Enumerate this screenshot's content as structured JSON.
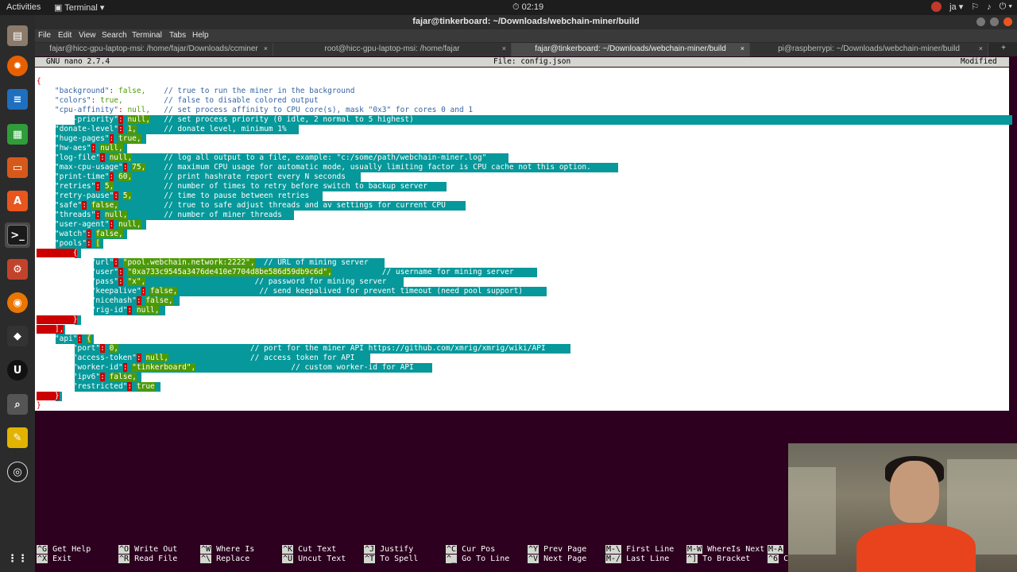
{
  "topbar": {
    "activities": "Activities",
    "app_menu": "Terminal ▾",
    "clock": "02:19",
    "language": "ja ▾"
  },
  "dock": {
    "items": [
      "files-icon",
      "firefox-icon",
      "writer-icon",
      "calc-icon",
      "impress-icon",
      "software-icon",
      "terminal-icon",
      "settings-icon",
      "blender-icon",
      "unity-icon",
      "unreal-icon",
      "search-icon",
      "editor-icon",
      "obs-icon",
      "apps-grid-icon"
    ]
  },
  "window": {
    "title": "fajar@tinkerboard: ~/Downloads/webchain-miner/build",
    "menu": [
      "File",
      "Edit",
      "View",
      "Search",
      "Terminal",
      "Tabs",
      "Help"
    ],
    "tabs": [
      {
        "label": "fajar@hicc-gpu-laptop-msi: /home/fajar/Downloads/ccminer",
        "close": "×"
      },
      {
        "label": "root@hicc-gpu-laptop-msi: /home/fajar",
        "close": "×"
      },
      {
        "label": "fajar@tinkerboard: ~/Downloads/webchain-miner/build",
        "close": "×"
      },
      {
        "label": "pi@raspberrypi: ~/Downloads/webchain-miner/build",
        "close": "×"
      }
    ],
    "tab_plus": "+"
  },
  "nano": {
    "version": "GNU nano 2.7.4",
    "file": "File: config.json",
    "status": "Modified",
    "lines": [
      "{",
      "    \"background\": false,    // true to run the miner in the background",
      "    \"colors\": true,         // false to disable colored output",
      "    \"cpu-affinity\": null,   // set process affinity to CPU core(s), mask \"0x3\" for cores 0 and 1",
      "    \"cpu-priority\": null,   // set process priority (0 idle, 2 normal to 5 highest)",
      "    \"donate-level\": 1,      // donate level, minimum 1%",
      "    \"huge-pages\": true,",
      "    \"hw-aes\": null,",
      "    \"log-file\": null,       // log all output to a file, example: \"c:/some/path/webchain-miner.log\"",
      "    \"max-cpu-usage\": 75,    // maximum CPU usage for automatic mode, usually limiting factor is CPU cache not this option.",
      "    \"print-time\": 60,       // print hashrate report every N seconds",
      "    \"retries\": 5,           // number of times to retry before switch to backup server",
      "    \"retry-pause\": 5,       // time to pause between retries",
      "    \"safe\": false,          // true to safe adjust threads and av settings for current CPU",
      "    \"threads\": null,        // number of miner threads",
      "    \"user-agent\": null,",
      "    \"watch\": false,",
      "    \"pools\": [",
      "        {",
      "            \"url\": \"pool.webchain.network:2222\",  // URL of mining server",
      "            \"user\": \"0xa733c9545a3476de410e7704d8be586d59db9c6d\",           // username for mining server",
      "            \"pass\": \"x\",                        // password for mining server",
      "            \"keepalive\": false,                  // send keepalived for prevent timeout (need pool support)",
      "            \"nicehash\": false,",
      "            \"rig-id\": null,",
      "        }",
      "    ],",
      "    \"api\": {",
      "        \"port\": 0,                             // port for the miner API https://github.com/xmrig/xmrig/wiki/API",
      "        \"access-token\": null,                  // access token for API",
      "        \"worker-id\": \"tinkerboard\",                     // custom worker-id for API",
      "        \"ipv6\": false,",
      "        \"restricted\": true",
      "    }",
      "}"
    ],
    "shortcuts": [
      {
        "key": "^G",
        "label": "Get Help"
      },
      {
        "key": "^X",
        "label": "Exit"
      },
      {
        "key": "^O",
        "label": "Write Out"
      },
      {
        "key": "^R",
        "label": "Read File"
      },
      {
        "key": "^W",
        "label": "Where Is"
      },
      {
        "key": "^\\",
        "label": "Replace"
      },
      {
        "key": "^K",
        "label": "Cut Text"
      },
      {
        "key": "^U",
        "label": "Uncut Text"
      },
      {
        "key": "^J",
        "label": "Justify"
      },
      {
        "key": "^T",
        "label": "To Spell"
      },
      {
        "key": "^C",
        "label": "Cur Pos"
      },
      {
        "key": "^_",
        "label": "Go To Line"
      },
      {
        "key": "^Y",
        "label": "Prev Page"
      },
      {
        "key": "^V",
        "label": "Next Page"
      },
      {
        "key": "M-\\",
        "label": "First Line"
      },
      {
        "key": "M-/",
        "label": "Last Line"
      },
      {
        "key": "M-W",
        "label": "WhereIs Next"
      },
      {
        "key": "^]",
        "label": "To Bracket"
      },
      {
        "key": "M-A",
        "label": "Ma"
      },
      {
        "key": "^6",
        "label": "C"
      }
    ]
  },
  "colors": {
    "terminal_bg": "#2c001e",
    "selection": "#06989a",
    "key": "#3465a4",
    "value_green": "#4e9a06",
    "value_red": "#cc0000"
  }
}
